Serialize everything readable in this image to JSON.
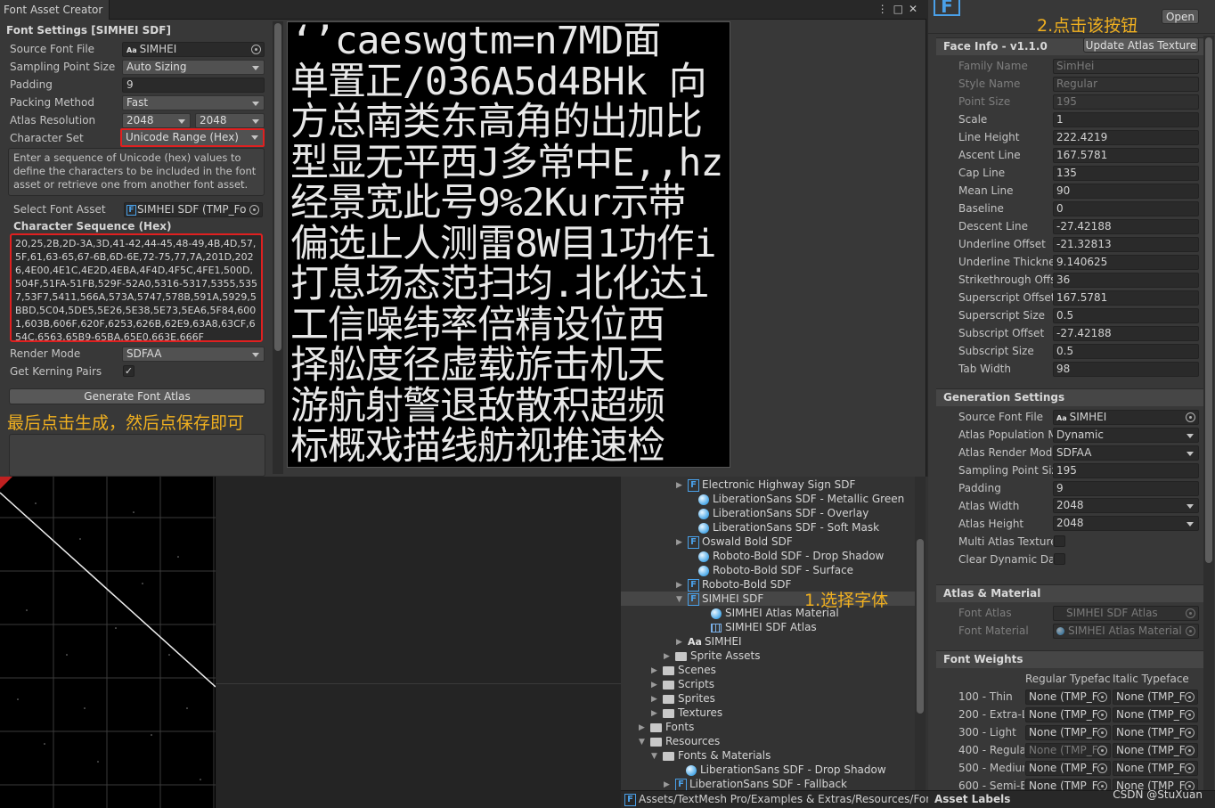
{
  "window": {
    "tab_title": "Font Asset Creator"
  },
  "font_settings": {
    "header": "Font Settings [SIMHEI SDF]",
    "source_font_file": {
      "label": "Source Font File",
      "value": "SIMHEI",
      "prefix": "Aa"
    },
    "sampling_point_size": {
      "label": "Sampling Point Size",
      "value": "Auto Sizing"
    },
    "padding": {
      "label": "Padding",
      "value": "9"
    },
    "packing_method": {
      "label": "Packing Method",
      "value": "Fast"
    },
    "atlas_resolution": {
      "label": "Atlas Resolution",
      "width": "2048",
      "height": "2048"
    },
    "character_set": {
      "label": "Character Set",
      "value": "Unicode Range (Hex)"
    },
    "help_text": "Enter a sequence of Unicode (hex) values to define the characters to be included in the font asset or retrieve one from another font asset.",
    "select_font_asset": {
      "label": "Select Font Asset",
      "value": "SIMHEI SDF (TMP_Fo"
    },
    "character_sequence": {
      "label": "Character Sequence (Hex)",
      "value": "20,25,2B,2D-3A,3D,41-42,44-45,48-49,4B,4D,57,5F,61,63-65,67-6B,6D-6E,72-75,77,7A,201D,2026,4E00,4E1C,4E2D,4EBA,4F4D,4F5C,4FE1,500D,504F,51FA-51FB,529F-52A0,5316-5317,5355,5357,53F7,5411,566A,573A,5747,578B,591A,5929,5BBD,5C04,5DE5,5E26,5E38,5E73,5EA6,5F84,6001,603B,606F,620F,6253,626B,62E9,63A8,63CF,654C,6563,65B9-65BA,65E0,663E,666F"
    },
    "render_mode": {
      "label": "Render Mode",
      "value": "SDFAA"
    },
    "kerning": {
      "label": "Get Kerning Pairs",
      "checked": true,
      "mark": "✓"
    },
    "generate_button": "Generate Font Atlas",
    "annotation": "最后点击生成，然后点保存即可"
  },
  "atlas_preview": {
    "lines": [
      "‘’caeswgtm=n7MD面",
      "单置正/036A5d4BHk 向",
      "方总南类东高角的出加比",
      "型显无平西J多常中E,,hz",
      "经景宽此号9%2Kur示带",
      "偏选止人测雷8W目1功作i",
      "打息场态范扫均.北化达i",
      "工信噪纬率倍精设位西",
      "择舩度径虚载旂击机天",
      "游航射警退敌散积超频",
      "标概戏描线舫视推速检"
    ]
  },
  "project": {
    "items": [
      {
        "label": "Electronic Highway Sign SDF",
        "icon": "font-asset-icon",
        "indent": 75,
        "arrow": "▶"
      },
      {
        "label": "LiberationSans SDF - Metallic Green",
        "icon": "material-icon",
        "indent": 87,
        "arrow": ""
      },
      {
        "label": "LiberationSans SDF - Overlay",
        "icon": "material-icon",
        "indent": 87,
        "arrow": ""
      },
      {
        "label": "LiberationSans SDF - Soft Mask",
        "icon": "material-icon",
        "indent": 87,
        "arrow": ""
      },
      {
        "label": "Oswald Bold SDF",
        "icon": "font-asset-icon",
        "indent": 75,
        "arrow": "▶"
      },
      {
        "label": "Roboto-Bold SDF - Drop Shadow",
        "icon": "material-icon",
        "indent": 87,
        "arrow": ""
      },
      {
        "label": "Roboto-Bold SDF - Surface",
        "icon": "material-icon",
        "indent": 87,
        "arrow": ""
      },
      {
        "label": "Roboto-Bold SDF",
        "icon": "font-asset-icon",
        "indent": 75,
        "arrow": "▶"
      },
      {
        "label": "SIMHEI SDF",
        "icon": "font-asset-icon",
        "indent": 75,
        "arrow": "▼",
        "selected": true
      },
      {
        "label": "SIMHEI Atlas Material",
        "icon": "material-icon",
        "indent": 101,
        "arrow": ""
      },
      {
        "label": "SIMHEI SDF Atlas",
        "icon": "texture-icon",
        "indent": 101,
        "arrow": ""
      },
      {
        "label": "SIMHEI",
        "icon": "font-file-icon",
        "indent": 75,
        "arrow": "▶"
      },
      {
        "label": "Sprite Assets",
        "icon": "folder-icon",
        "indent": 61,
        "arrow": "▶"
      },
      {
        "label": "Scenes",
        "icon": "folder-icon",
        "indent": 47,
        "arrow": "▶"
      },
      {
        "label": "Scripts",
        "icon": "folder-icon",
        "indent": 47,
        "arrow": "▶"
      },
      {
        "label": "Sprites",
        "icon": "folder-icon",
        "indent": 47,
        "arrow": "▶"
      },
      {
        "label": "Textures",
        "icon": "folder-icon",
        "indent": 47,
        "arrow": "▶"
      },
      {
        "label": "Fonts",
        "icon": "folder-icon",
        "indent": 33,
        "arrow": "▶"
      },
      {
        "label": "Resources",
        "icon": "folder-icon",
        "indent": 33,
        "arrow": "▼"
      },
      {
        "label": "Fonts & Materials",
        "icon": "folder-icon",
        "indent": 47,
        "arrow": "▼"
      },
      {
        "label": "LiberationSans SDF - Drop Shadow",
        "icon": "material-icon",
        "indent": 73,
        "arrow": ""
      },
      {
        "label": "LiberationSans SDF - Fallback",
        "icon": "font-asset-icon",
        "indent": 61,
        "arrow": "▶"
      }
    ],
    "annotation": "1.选择字体",
    "path": "Assets/TextMesh Pro/Examples & Extras/Resources/Font"
  },
  "inspector": {
    "open_button": "Open",
    "annotation": "2.点击该按钮",
    "face_info": {
      "header": "Face Info - v1.1.0",
      "update_button": "Update Atlas Texture",
      "fields": [
        {
          "label": "Family Name",
          "value": "SimHei",
          "disabled": true
        },
        {
          "label": "Style Name",
          "value": "Regular",
          "disabled": true
        },
        {
          "label": "Point Size",
          "value": "195",
          "disabled": true
        },
        {
          "label": "Scale",
          "value": "1",
          "disabled": false
        },
        {
          "label": "Line Height",
          "value": "222.4219",
          "disabled": false
        },
        {
          "label": "Ascent Line",
          "value": "167.5781",
          "disabled": false
        },
        {
          "label": "Cap Line",
          "value": "135",
          "disabled": false
        },
        {
          "label": "Mean Line",
          "value": "90",
          "disabled": false
        },
        {
          "label": "Baseline",
          "value": "0",
          "disabled": false
        },
        {
          "label": "Descent Line",
          "value": "-27.42188",
          "disabled": false
        },
        {
          "label": "Underline Offset",
          "value": "-21.32813",
          "disabled": false
        },
        {
          "label": "Underline Thickne",
          "value": "9.140625",
          "disabled": false
        },
        {
          "label": "Strikethrough Offs",
          "value": "36",
          "disabled": false
        },
        {
          "label": "Superscript Offset",
          "value": "167.5781",
          "disabled": false
        },
        {
          "label": "Superscript Size",
          "value": "0.5",
          "disabled": false
        },
        {
          "label": "Subscript Offset",
          "value": "-27.42188",
          "disabled": false
        },
        {
          "label": "Subscript Size",
          "value": "0.5",
          "disabled": false
        },
        {
          "label": "Tab Width",
          "value": "98",
          "disabled": false
        }
      ]
    },
    "generation": {
      "header": "Generation Settings",
      "source_font_file": {
        "label": "Source Font File",
        "value": "SIMHEI",
        "prefix": "Aa"
      },
      "atlas_population": {
        "label": "Atlas Population M",
        "value": "Dynamic"
      },
      "atlas_render_mode": {
        "label": "Atlas Render Mode",
        "value": "SDFAA"
      },
      "sampling_point_size": {
        "label": "Sampling Point Siz",
        "value": "195"
      },
      "padding": {
        "label": "Padding",
        "value": "9"
      },
      "atlas_width": {
        "label": "Atlas Width",
        "value": "2048"
      },
      "atlas_height": {
        "label": "Atlas Height",
        "value": "2048"
      },
      "multi_atlas": {
        "label": "Multi Atlas Texture"
      },
      "clear_dynamic": {
        "label": "Clear Dynamic Dat"
      }
    },
    "atlas_material": {
      "header": "Atlas & Material",
      "font_atlas": {
        "label": "Font Atlas",
        "value": "SIMHEI SDF Atlas"
      },
      "font_material": {
        "label": "Font Material",
        "value": "SIMHEI Atlas Material"
      }
    },
    "font_weights": {
      "header": "Font Weights",
      "col_regular": "Regular Typeface",
      "col_italic": "Italic Typeface",
      "rows": [
        {
          "label": "100 - Thin",
          "regular": "None (TMP_F",
          "italic": "None (TMP_F"
        },
        {
          "label": "200 - Extra-L",
          "regular": "None (TMP_F",
          "italic": "None (TMP_F"
        },
        {
          "label": "300 - Light",
          "regular": "None (TMP_F",
          "italic": "None (TMP_F"
        },
        {
          "label": "400 - Regula",
          "regular": "None (TMP_F",
          "italic": "None (TMP_F"
        },
        {
          "label": "500 - Mediun",
          "regular": "None (TMP_F",
          "italic": "None (TMP_F"
        },
        {
          "label": "600 - Semi-E",
          "regular": "None (TMP_F",
          "italic": "None (TMP_F"
        }
      ]
    },
    "asset_labels": "Asset Labels",
    "watermark": "CSDN @StuXuan"
  },
  "colors": {
    "highlight": "#e02020",
    "annotation": "#f0b020",
    "font_icon": "#4aa0e8"
  }
}
